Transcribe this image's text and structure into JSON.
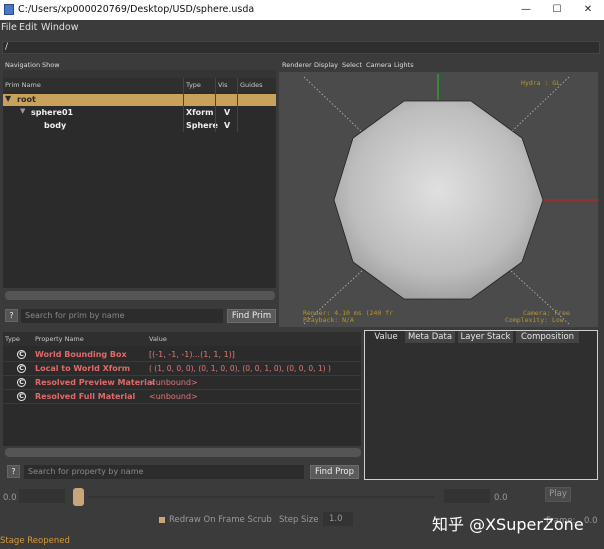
{
  "window": {
    "title": "C:/Users/xp000020769/Desktop/USD/sphere.usda",
    "minimize": "—",
    "maximize": "☐",
    "close": "✕"
  },
  "menubar": [
    "File",
    "Edit",
    "Window"
  ],
  "path": "/",
  "prim_panel": {
    "menu": [
      "Navigation",
      "Show"
    ],
    "columns": [
      "Prim Name",
      "Type",
      "Vis",
      "Guides"
    ],
    "rows": [
      {
        "name": "root",
        "type": "",
        "vis": "",
        "expanded": true,
        "selected": true
      },
      {
        "name": "sphere01",
        "type": "Xform",
        "vis": "V",
        "expanded": true
      },
      {
        "name": "body",
        "type": "Sphere",
        "vis": "V"
      }
    ],
    "search_placeholder": "Search for prim by name",
    "help": "?",
    "find_button": "Find Prim"
  },
  "viewport": {
    "menu": [
      "Renderer",
      "Display",
      "Select",
      "Camera",
      "Lights"
    ],
    "hud_top_right": "Hydra : GL",
    "hud_bottom_left": [
      "Render: 4.10 ms (240 fr",
      "Playback: N/A"
    ],
    "hud_bottom_right": [
      "Camera: Free",
      "Complexity: Low"
    ]
  },
  "property_panel": {
    "columns": [
      "Type",
      "Property Name",
      "Value"
    ],
    "rows": [
      {
        "icon": "C",
        "name": "World Bounding Box",
        "value": "[(-1, -1, -1)...(1, 1, 1)]"
      },
      {
        "icon": "C",
        "name": "Local to World Xform",
        "value": "( (1, 0, 0, 0), (0, 1, 0, 0), (0, 0, 1, 0), (0, 0, 0, 1) )"
      },
      {
        "icon": "C",
        "name": "Resolved Preview Material",
        "value": "<unbound>"
      },
      {
        "icon": "C",
        "name": "Resolved Full Material",
        "value": "<unbound>"
      }
    ],
    "search_placeholder": "Search for property by name",
    "help": "?",
    "find_button": "Find Prop"
  },
  "tabs": [
    "Value",
    "Meta Data",
    "Layer Stack",
    "Composition"
  ],
  "timeline": {
    "start": "0.0",
    "end": "0.0",
    "play": "Play",
    "frame_label": "Frame:",
    "frame_value": "0.0",
    "redraw_label": "Redraw On Frame Scrub",
    "step_label": "Step Size",
    "step_value": "1.0"
  },
  "status": "Stage Reopened",
  "watermark": "知乎 @XSuperZone",
  "colors": {
    "selected_row": "#c8a15a",
    "property_name": "#e06a6a",
    "status": "#d79b3c",
    "hud": "#b89628"
  }
}
